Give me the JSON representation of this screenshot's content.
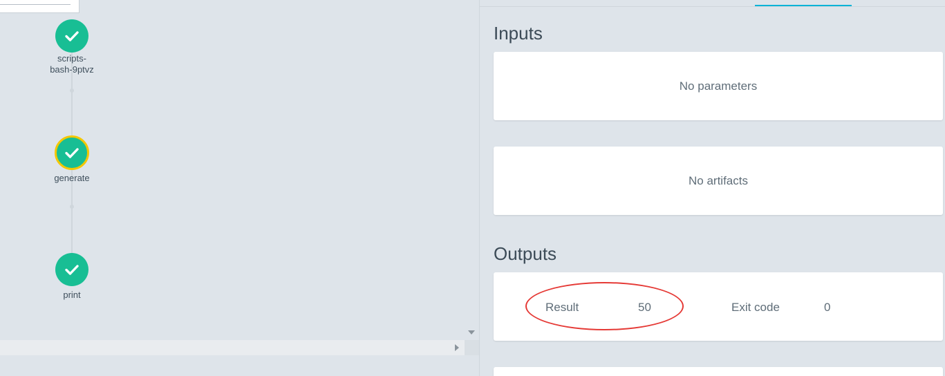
{
  "graph": {
    "nodes": [
      {
        "id": "scripts-bash",
        "label": "scripts-\nbash-9ptvz",
        "status": "succeeded",
        "selected": false
      },
      {
        "id": "generate",
        "label": "generate",
        "status": "succeeded",
        "selected": true
      },
      {
        "id": "print",
        "label": "print",
        "status": "succeeded",
        "selected": false
      }
    ],
    "icon": "check-icon",
    "colors": {
      "success": "#18be94",
      "selected_ring": "#f4c700",
      "edge": "#cfd6dc"
    }
  },
  "details": {
    "tab_indicator_color": "#00b3d7",
    "inputs": {
      "title": "Inputs",
      "parameters_empty": "No parameters",
      "artifacts_empty": "No artifacts"
    },
    "outputs": {
      "title": "Outputs",
      "result_label": "Result",
      "result_value": "50",
      "exit_code_label": "Exit code",
      "exit_code_value": "0"
    }
  },
  "annotation": {
    "shape": "ellipse",
    "color": "#e53935",
    "highlights": "result"
  }
}
